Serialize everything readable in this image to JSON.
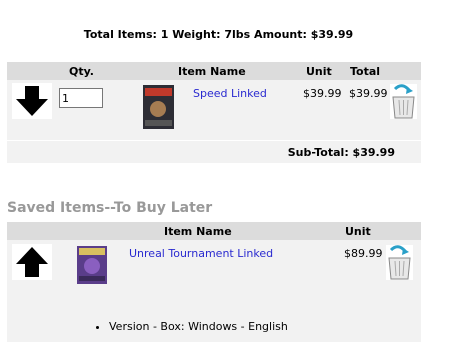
{
  "summary": {
    "text": "Total Items: 1  Weight: 7lbs  Amount: $39.99"
  },
  "cart": {
    "columns": {
      "qty": "Qty.",
      "name": "Item Name",
      "unit": "Unit",
      "total": "Total"
    },
    "item": {
      "qty": "1",
      "name": "Speed Linked",
      "unit": "$39.99",
      "total": "$39.99"
    },
    "subtotal": "Sub-Total: $39.99"
  },
  "saved": {
    "title": "Saved Items--To Buy Later",
    "columns": {
      "name": "Item Name",
      "unit": "Unit"
    },
    "item": {
      "name": "Unreal Tournament Linked",
      "unit": "$89.99",
      "option": "Version - Box: Windows - English"
    }
  }
}
